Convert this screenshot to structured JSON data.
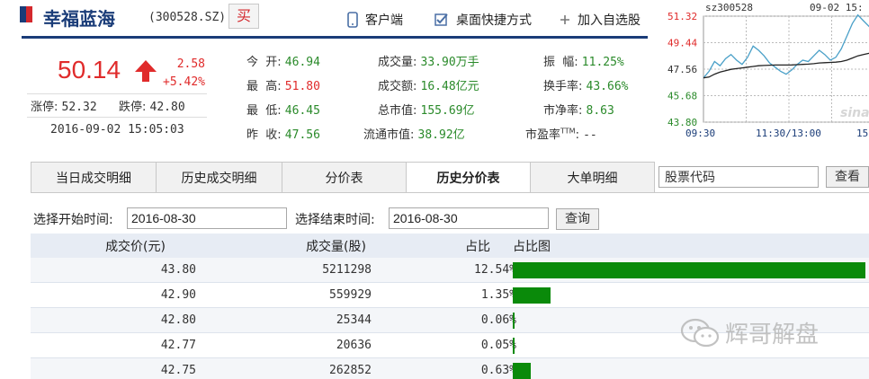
{
  "header": {
    "stock_name": "幸福蓝海",
    "stock_code": "(300528.SZ)",
    "buy_label": "买",
    "links": {
      "client": "客户端",
      "desktop_shortcut": "桌面快捷方式",
      "add_watchlist": "加入自选股"
    },
    "colors": {
      "brand_blue": "#1a3c78",
      "red": "#d4282d"
    }
  },
  "quote": {
    "price": "50.14",
    "change_abs": "2.58",
    "change_pct": "+5.42%",
    "limit_up_label": "涨停:",
    "limit_up": "52.32",
    "limit_down_label": "跌停:",
    "limit_down": "42.80",
    "datetime": "2016-09-02 15:05:03",
    "direction_icon": "up-arrow-icon"
  },
  "stats": {
    "open": {
      "label": "今  开:",
      "value": "46.94"
    },
    "high": {
      "label": "最  高:",
      "value": "51.80"
    },
    "low": {
      "label": "最  低:",
      "value": "46.45"
    },
    "prev_close": {
      "label": "昨  收:",
      "value": "47.56"
    },
    "volume": {
      "label": "成交量:",
      "value": "33.90万手"
    },
    "amount": {
      "label": "成交额:",
      "value": "16.48亿元"
    },
    "market_cap": {
      "label": "总市值:",
      "value": "155.69亿"
    },
    "float_cap": {
      "label": "流通市值:",
      "value": "38.92亿"
    },
    "amplitude": {
      "label": "振  幅:",
      "value": "11.25%"
    },
    "turnover": {
      "label": "换手率:",
      "value": "43.66%"
    },
    "pb": {
      "label": "市净率:",
      "value": "8.63"
    },
    "pe_ttm": {
      "label": "市盈率",
      "sup": "TTM",
      "colon": ":",
      "value": "--"
    }
  },
  "mini_chart": {
    "code": "sz300528",
    "date": "09-02 15:",
    "y_labels": [
      "51.32",
      "49.44",
      "47.56",
      "45.68",
      "43.80"
    ],
    "x_labels": [
      "09:30",
      "11:30/13:00",
      "15"
    ],
    "logo": "sina",
    "price_series": [
      46.94,
      47.4,
      48.1,
      47.8,
      48.3,
      48.6,
      48.2,
      47.9,
      48.4,
      49.2,
      48.9,
      48.5,
      48.0,
      47.7,
      47.4,
      47.2,
      47.5,
      47.9,
      48.2,
      48.1,
      48.5,
      48.9,
      48.6,
      48.2,
      48.4,
      49.0,
      49.9,
      50.8,
      51.4,
      51.0,
      50.6,
      51.1
    ],
    "avg_series": [
      46.94,
      47.0,
      47.2,
      47.35,
      47.45,
      47.55,
      47.6,
      47.65,
      47.7,
      47.75,
      47.8,
      47.82,
      47.84,
      47.85,
      47.85,
      47.85,
      47.86,
      47.88,
      47.9,
      47.92,
      47.95,
      48.0,
      48.02,
      48.04,
      48.06,
      48.1,
      48.2,
      48.35,
      48.5,
      48.6,
      48.68,
      48.75
    ]
  },
  "tabs": [
    {
      "label": "当日成交明细",
      "active": false
    },
    {
      "label": "历史成交明细",
      "active": false
    },
    {
      "label": "分价表",
      "active": false
    },
    {
      "label": "历史分价表",
      "active": true
    },
    {
      "label": "大单明细",
      "active": false
    }
  ],
  "search": {
    "value": "股票代码",
    "button": "查看"
  },
  "filter": {
    "start_label": "选择开始时间:",
    "start_value": "2016-08-30",
    "end_label": "选择结束时间:",
    "end_value": "2016-08-30",
    "query_button": "查询"
  },
  "table": {
    "headers": [
      "成交价(元)",
      "成交量(股)",
      "占比",
      "占比图"
    ],
    "rows": [
      {
        "price": "43.80",
        "volume": "5211298",
        "pct": "12.54%",
        "ratio": 12.54
      },
      {
        "price": "42.90",
        "volume": "559929",
        "pct": "1.35%",
        "ratio": 1.35
      },
      {
        "price": "42.80",
        "volume": "25344",
        "pct": "0.06%",
        "ratio": 0.06
      },
      {
        "price": "42.77",
        "volume": "20636",
        "pct": "0.05%",
        "ratio": 0.05
      },
      {
        "price": "42.75",
        "volume": "262852",
        "pct": "0.63%",
        "ratio": 0.63
      }
    ],
    "bar_color": "#0a8a0a",
    "max_ratio": 12.54
  },
  "watermark": {
    "text": "辉哥解盘",
    "icon": "wechat-icon"
  }
}
